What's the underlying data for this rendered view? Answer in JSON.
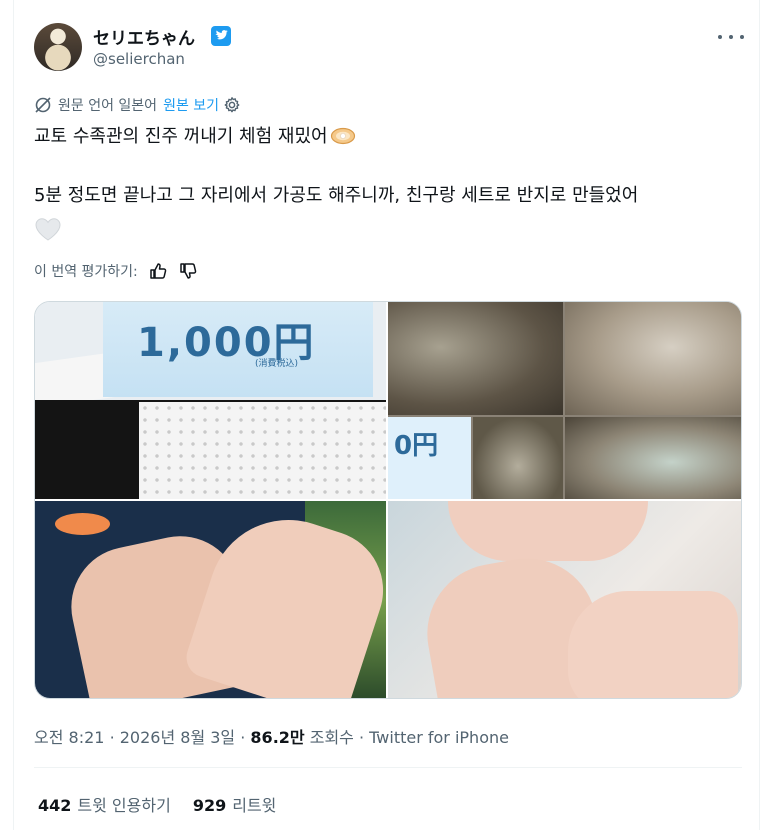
{
  "author": {
    "display_name": "セリエちゃん",
    "handle": "@selierchan",
    "verified": true
  },
  "translation": {
    "notice": "원문 언어 일본어",
    "show_original": "원본 보기"
  },
  "tweet": {
    "line1": "교토 수족관의 진주 꺼내기 체험 재밌어",
    "line2": "5분 정도면 끝나고 그 자리에서 가공도 해주니까, 친구랑 세트로 반지로 만들었어"
  },
  "rate": {
    "label": "이 번역 평가하기:"
  },
  "media": {
    "price_text": "1,000円",
    "price_sub": "(消費税込)",
    "price_text_2": "0円"
  },
  "meta": {
    "time": "오전 8:21",
    "date": "2026년 8월 3일",
    "views_count": "86.2만",
    "views_label": "조회수",
    "source": "Twitter for iPhone"
  },
  "stats": {
    "quotes_count": "442",
    "quotes_label": "트윗 인용하기",
    "retweets_count": "929",
    "retweets_label": "리트윗"
  },
  "colors": {
    "accent": "#1d9bf0",
    "text_primary": "#0f1419",
    "text_secondary": "#536471"
  }
}
